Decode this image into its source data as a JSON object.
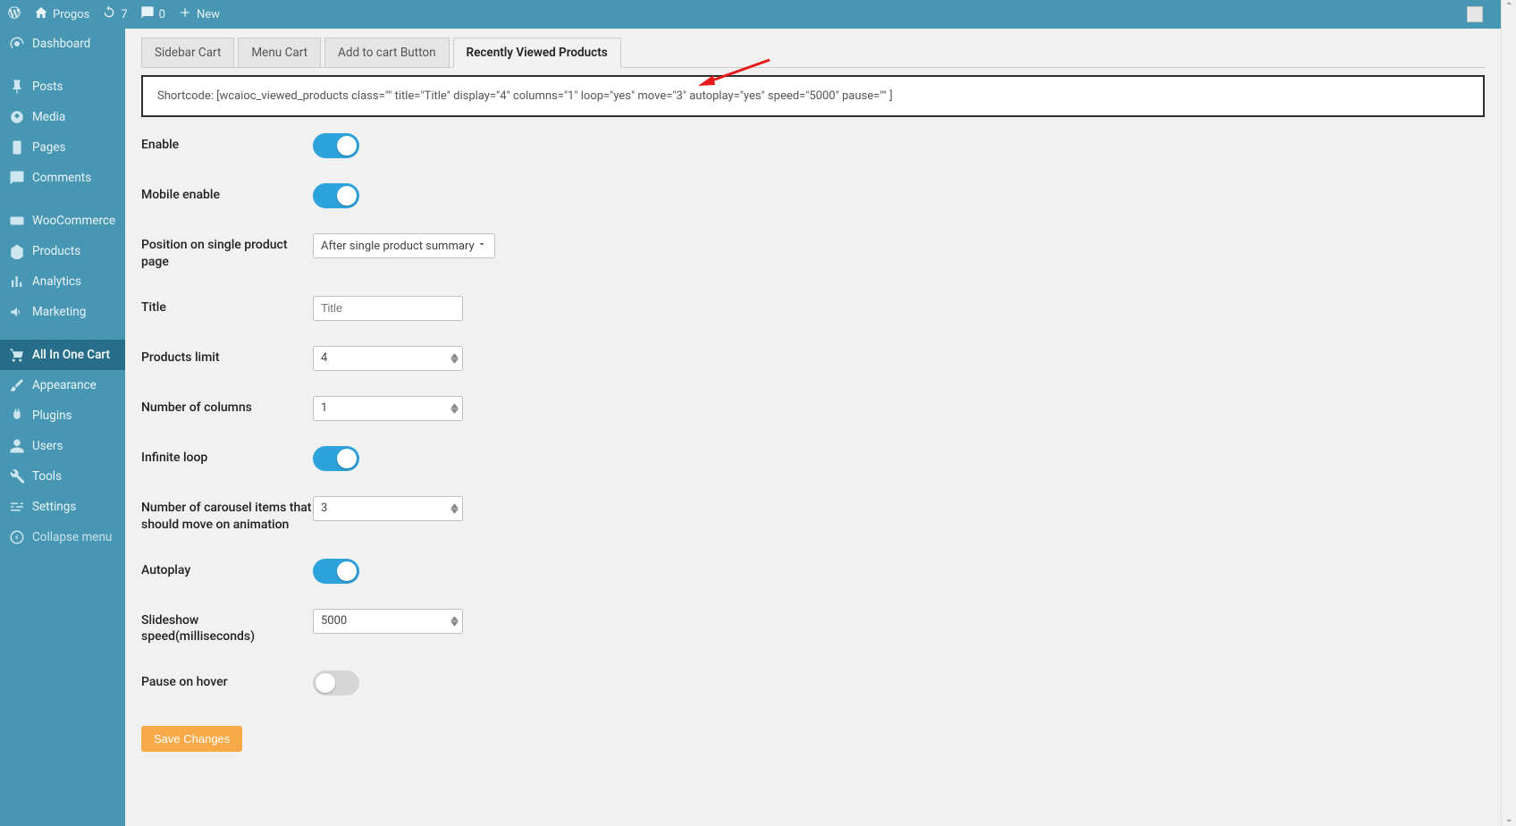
{
  "adminbar": {
    "site_name": "Progos",
    "updates_count": "7",
    "comments_count": "0",
    "new_label": "New"
  },
  "sidebar": {
    "items": [
      {
        "label": "Dashboard"
      },
      {
        "label": "Posts"
      },
      {
        "label": "Media"
      },
      {
        "label": "Pages"
      },
      {
        "label": "Comments"
      },
      {
        "label": "WooCommerce"
      },
      {
        "label": "Products"
      },
      {
        "label": "Analytics"
      },
      {
        "label": "Marketing"
      },
      {
        "label": "All In One Cart"
      },
      {
        "label": "Appearance"
      },
      {
        "label": "Plugins"
      },
      {
        "label": "Users"
      },
      {
        "label": "Tools"
      },
      {
        "label": "Settings"
      },
      {
        "label": "Collapse menu"
      }
    ]
  },
  "tabs": [
    {
      "label": "Sidebar Cart"
    },
    {
      "label": "Menu Cart"
    },
    {
      "label": "Add to cart Button"
    },
    {
      "label": "Recently Viewed Products"
    }
  ],
  "shortcode": "Shortcode: [wcaioc_viewed_products class=\"\" title=\"Title\" display=\"4\" columns=\"1\" loop=\"yes\" move=\"3\" autoplay=\"yes\" speed=\"5000\" pause=\"\" ]",
  "form": {
    "enable": {
      "label": "Enable",
      "value": true
    },
    "mobile_enable": {
      "label": "Mobile enable",
      "value": true
    },
    "position": {
      "label": "Position on single product page",
      "value": "After single product summary"
    },
    "title": {
      "label": "Title",
      "placeholder": "Title",
      "value": ""
    },
    "products_limit": {
      "label": "Products limit",
      "value": "4"
    },
    "num_columns": {
      "label": "Number of columns",
      "value": "1"
    },
    "infinite_loop": {
      "label": "Infinite loop",
      "value": true
    },
    "carousel_move": {
      "label": "Number of carousel items that should move on animation",
      "value": "3"
    },
    "autoplay": {
      "label": "Autoplay",
      "value": true
    },
    "speed": {
      "label": "Slideshow speed(milliseconds)",
      "value": "5000"
    },
    "pause_hover": {
      "label": "Pause on hover",
      "value": false
    }
  },
  "buttons": {
    "save": "Save Changes"
  }
}
